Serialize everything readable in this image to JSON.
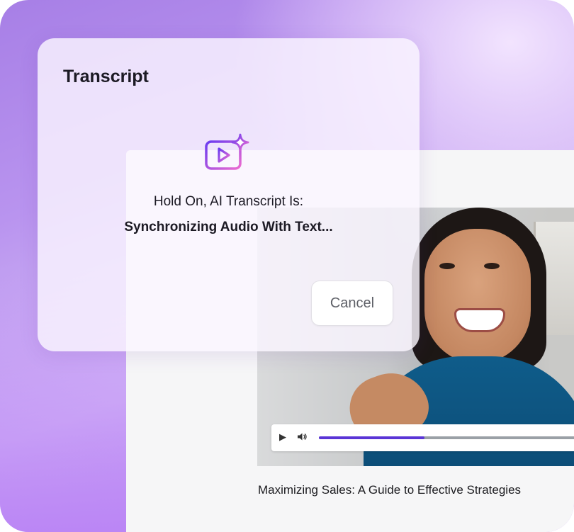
{
  "dialog": {
    "title": "Transcript",
    "status_heading": "Hold On, AI Transcript Is:",
    "status_detail": "Synchronizing Audio With Text...",
    "cancel_label": "Cancel",
    "icon": "ai-video-sparkle-icon"
  },
  "player": {
    "video_title": "Maximizing Sales: A Guide to Effective Strategies",
    "progress": 0.4,
    "play_icon": "play-icon",
    "volume_icon": "volume-icon"
  },
  "colors": {
    "accent_purple": "#5a35d6",
    "icon_gradient_start": "#6a3cf0",
    "icon_gradient_end": "#ec6bd0",
    "background_purple": "#b48cf0"
  }
}
